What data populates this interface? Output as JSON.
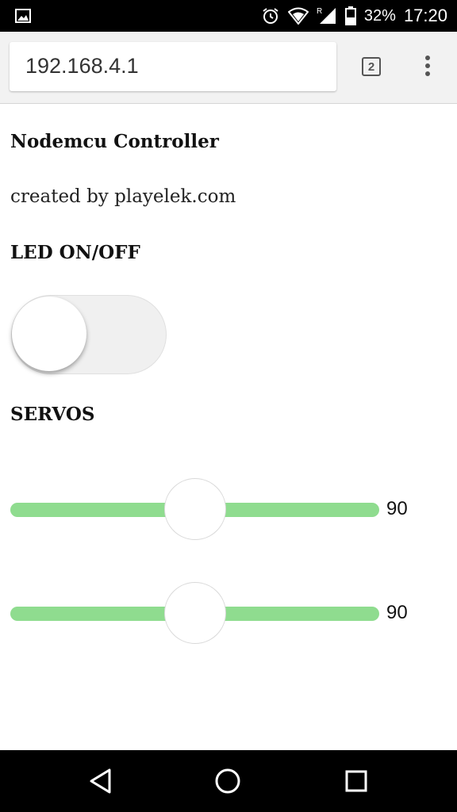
{
  "status_bar": {
    "battery": "32%",
    "time": "17:20",
    "icons": [
      "image-icon",
      "alarm-icon",
      "wifi-icon",
      "signal-icon",
      "battery-icon"
    ]
  },
  "browser": {
    "url": "192.168.4.1",
    "tab_count": "2",
    "menu_icon": "more-vert-icon"
  },
  "page": {
    "title": "Nodemcu Controller",
    "credit": "created by playelek.com",
    "led_label": "LED ON/OFF",
    "led_state": false,
    "servos_label": "SERVOS",
    "servos": [
      {
        "value": "90",
        "fraction": 0.5
      },
      {
        "value": "90",
        "fraction": 0.5
      }
    ]
  },
  "colors": {
    "slider_track": "#8fdc8f",
    "toggle_off": "#f0f0f0"
  },
  "nav": {
    "icons": [
      "back-icon",
      "home-icon",
      "recents-icon"
    ]
  }
}
